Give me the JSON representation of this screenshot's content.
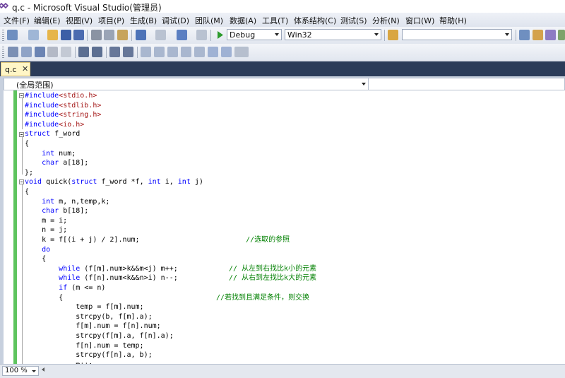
{
  "window": {
    "title": "q.c - Microsoft Visual Studio(管理员)"
  },
  "menu": [
    "文件(F)",
    "编辑(E)",
    "视图(V)",
    "项目(P)",
    "生成(B)",
    "调试(D)",
    "团队(M)",
    "数据(A)",
    "工具(T)",
    "体系结构(C)",
    "测试(S)",
    "分析(N)",
    "窗口(W)",
    "帮助(H)"
  ],
  "toolbar": {
    "configuration": "Debug",
    "platform": "Win32",
    "find_value": "",
    "icons": [
      "new-project-icon",
      "add-item-icon",
      "open-file-icon",
      "save-icon",
      "save-all-icon",
      "cut-icon",
      "copy-icon",
      "paste-icon",
      "undo-icon",
      "redo-icon",
      "navigate-backward-icon",
      "navigate-forward-icon",
      "start-debugging-icon",
      "find-in-files-icon",
      "solution-explorer-icon",
      "properties-icon",
      "object-browser-icon",
      "toolbox-icon"
    ],
    "icons2": [
      "select-all-icon",
      "list-members-icon",
      "parameter-info-icon",
      "quick-info-icon",
      "complete-word-icon",
      "decrease-indent-icon",
      "increase-indent-icon",
      "comment-icon",
      "uncomment-icon",
      "bookmark-icon",
      "prev-bookmark-icon",
      "next-bookmark-icon",
      "prev-bookmark-folder-icon",
      "next-bookmark-folder-icon",
      "clear-bookmarks-icon",
      "more-options-icon"
    ]
  },
  "tab": {
    "label": "q.c",
    "close_glyph": "✕"
  },
  "navbar": {
    "scope": "(全局范围)",
    "members": ""
  },
  "code": [
    [
      {
        "t": "#include",
        "c": "kw"
      },
      {
        "t": "<stdio.h>",
        "c": "str"
      }
    ],
    [
      {
        "t": "#include",
        "c": "kw"
      },
      {
        "t": "<stdlib.h>",
        "c": "str"
      }
    ],
    [
      {
        "t": "#include",
        "c": "kw"
      },
      {
        "t": "<string.h>",
        "c": "str"
      }
    ],
    [
      {
        "t": "#include",
        "c": "kw"
      },
      {
        "t": "<io.h>",
        "c": "str"
      }
    ],
    [
      {
        "t": "struct",
        "c": "kw"
      },
      {
        "t": " f_word",
        "c": "plain"
      }
    ],
    [
      {
        "t": "{",
        "c": "plain"
      }
    ],
    [
      {
        "t": "    ",
        "c": "plain"
      },
      {
        "t": "int",
        "c": "kw"
      },
      {
        "t": " num;",
        "c": "plain"
      }
    ],
    [
      {
        "t": "    ",
        "c": "plain"
      },
      {
        "t": "char",
        "c": "kw"
      },
      {
        "t": " a[18];",
        "c": "plain"
      }
    ],
    [
      {
        "t": "};",
        "c": "plain"
      }
    ],
    [
      {
        "t": "void",
        "c": "kw"
      },
      {
        "t": " quick(",
        "c": "plain"
      },
      {
        "t": "struct",
        "c": "kw"
      },
      {
        "t": " f_word *f, ",
        "c": "plain"
      },
      {
        "t": "int",
        "c": "kw"
      },
      {
        "t": " i, ",
        "c": "plain"
      },
      {
        "t": "int",
        "c": "kw"
      },
      {
        "t": " j)",
        "c": "plain"
      }
    ],
    [
      {
        "t": "{",
        "c": "plain"
      }
    ],
    [
      {
        "t": "    ",
        "c": "plain"
      },
      {
        "t": "int",
        "c": "kw"
      },
      {
        "t": " m, n,temp,k;",
        "c": "plain"
      }
    ],
    [
      {
        "t": "    ",
        "c": "plain"
      },
      {
        "t": "char",
        "c": "kw"
      },
      {
        "t": " b[18];",
        "c": "plain"
      }
    ],
    [
      {
        "t": "    m = i;",
        "c": "plain"
      }
    ],
    [
      {
        "t": "    n = j;",
        "c": "plain"
      }
    ],
    [
      {
        "t": "    k = f[(i + j) / 2].num;                         ",
        "c": "plain"
      },
      {
        "t": "//选取的参照",
        "c": "cmt"
      }
    ],
    [
      {
        "t": "    ",
        "c": "plain"
      },
      {
        "t": "do",
        "c": "kw"
      }
    ],
    [
      {
        "t": "    {",
        "c": "plain"
      }
    ],
    [
      {
        "t": "        ",
        "c": "plain"
      },
      {
        "t": "while",
        "c": "kw"
      },
      {
        "t": " (f[m].num>k&&m<j) m++;            ",
        "c": "plain"
      },
      {
        "t": "// 从左到右找比k小的元素",
        "c": "cmt"
      }
    ],
    [
      {
        "t": "        ",
        "c": "plain"
      },
      {
        "t": "while",
        "c": "kw"
      },
      {
        "t": " (f[n].num<k&&n>i) n--;            ",
        "c": "plain"
      },
      {
        "t": "// 从右到左找比k大的元素",
        "c": "cmt"
      }
    ],
    [
      {
        "t": "        ",
        "c": "plain"
      },
      {
        "t": "if",
        "c": "kw"
      },
      {
        "t": " (m <= n)",
        "c": "plain"
      }
    ],
    [
      {
        "t": "        {                                    ",
        "c": "plain"
      },
      {
        "t": "//若找到且满足条件，则交换",
        "c": "cmt"
      }
    ],
    [
      {
        "t": "            temp = f[m].num;",
        "c": "plain"
      }
    ],
    [
      {
        "t": "            strcpy(b, f[m].a);",
        "c": "plain"
      }
    ],
    [
      {
        "t": "            f[m].num = f[n].num;",
        "c": "plain"
      }
    ],
    [
      {
        "t": "            strcpy(f[m].a, f[n].a);",
        "c": "plain"
      }
    ],
    [
      {
        "t": "            f[n].num = temp;",
        "c": "plain"
      }
    ],
    [
      {
        "t": "            strcpy(f[n].a, b);",
        "c": "plain"
      }
    ],
    [
      {
        "t": "            m++;",
        "c": "plain"
      }
    ]
  ],
  "status": {
    "zoom": "100 %"
  }
}
